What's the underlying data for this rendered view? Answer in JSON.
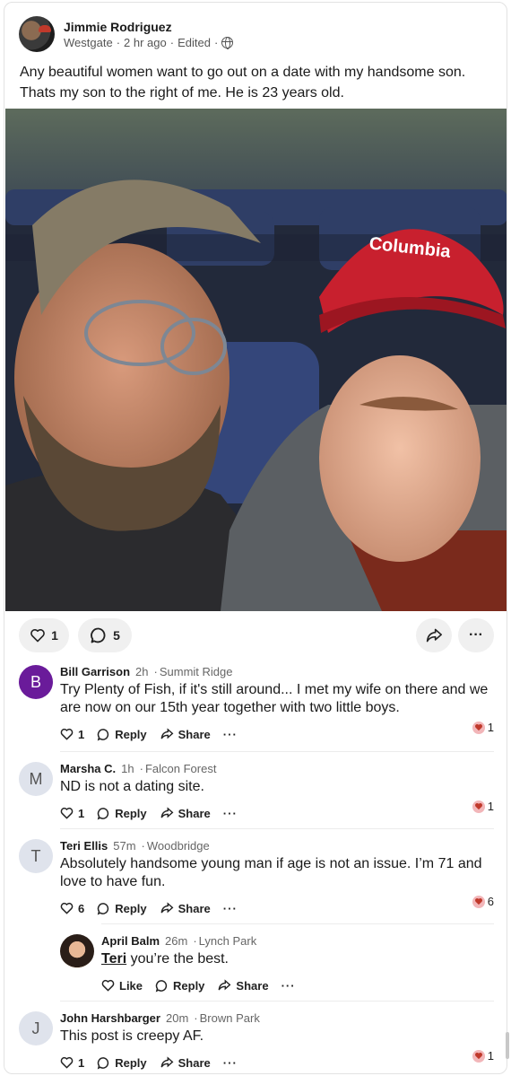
{
  "post": {
    "author": "Jimmie Rodriguez",
    "location": "Westgate",
    "time": "2 hr ago",
    "edited": "Edited",
    "sep": "·",
    "text": "Any beautiful women want to go out on a date with my handsome son. Thats my son to the right of me. He is 23 years old.",
    "photo_brand": "Columbia",
    "likes": "1",
    "comments_count": "5"
  },
  "labels": {
    "reply": "Reply",
    "share": "Share",
    "like": "Like",
    "more": "···"
  },
  "comments": [
    {
      "initial": "B",
      "avatar_color": "#6a1b9a",
      "name": "Bill Garrison",
      "time": "2h",
      "location": "Summit Ridge",
      "text": "Try Plenty of Fish, if it's still around... I met my wife on there and we are now on our 15th year together with two little boys.",
      "likes": "1",
      "reactions": "1"
    },
    {
      "initial": "M",
      "avatar_color": "#dfe3ec",
      "name": "Marsha C.",
      "time": "1h",
      "location": "Falcon Forest",
      "text": "ND is not a dating site.",
      "likes": "1",
      "reactions": "1"
    },
    {
      "initial": "T",
      "avatar_color": "#dfe3ec",
      "name": "Teri Ellis",
      "time": "57m",
      "location": "Woodbridge",
      "text": "Absolutely handsome young man if age is not an issue.  I’m 71 and love to have fun.",
      "likes": "6",
      "reactions": "6"
    },
    {
      "name": "April Balm",
      "time": "26m",
      "location": "Lynch Park",
      "mention": "Teri",
      "text": " you’re the best."
    },
    {
      "initial": "J",
      "avatar_color": "#dfe3ec",
      "name": "John Harshbarger",
      "time": "20m",
      "location": "Brown Park",
      "text": "This post is creepy AF.",
      "likes": "1",
      "reactions": "1"
    }
  ]
}
